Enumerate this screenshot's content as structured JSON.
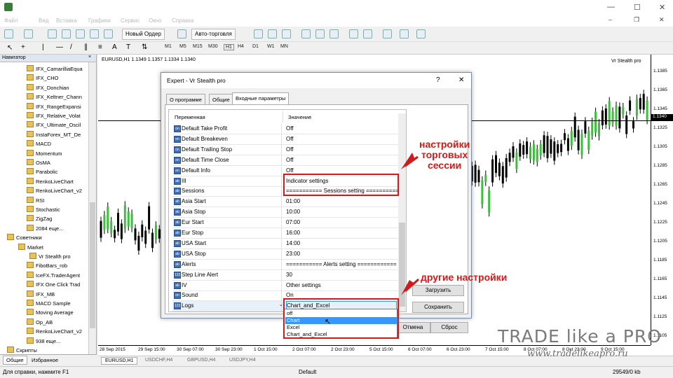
{
  "menu": [
    "Файл",
    "Вид",
    "Вставка",
    "Графики",
    "Сервис",
    "Окно",
    "Справка"
  ],
  "toolbar": {
    "new_order": "Новый Ордер",
    "auto_trading": "Авто-торговля"
  },
  "timeframes": [
    "M1",
    "M5",
    "M15",
    "M30",
    "H1",
    "H4",
    "D1",
    "W1",
    "MN"
  ],
  "navigator": {
    "title": "Навигатор",
    "items": [
      "IFX_CamarilliaEqua",
      "IFX_CHO",
      "IFX_Donchian",
      "IFX_Keltner_Chann",
      "IFX_RangeExpansi",
      "IFX_Relative_Volat",
      "IFX_Ultimate_Oscil",
      "InstaForex_MT_De",
      "MACD",
      "Momentum",
      "OsMA",
      "Parabolic",
      "RenkoLiveChart",
      "RenkoLiveChart_v2",
      "RSI",
      "Stochastic",
      "ZigZag",
      "2084 еще..."
    ],
    "advisors_label": "Советники",
    "market_label": "Market",
    "market_item": "Vr Stealth pro",
    "advisor_items": [
      "FiboBars_rob",
      "IceFX.TraderAgent",
      "IFX One Click Trad",
      "IFX_MB",
      "MACD Sample",
      "Moving Average",
      "Op_AB",
      "RenkoLiveChart_v2",
      "938 еще..."
    ],
    "scripts_label": "Скрипты",
    "tabs": [
      "Общие",
      "Избранное"
    ]
  },
  "chart": {
    "header": "EURUSD,H1  1.1349 1.1357 1.1334 1.1340",
    "name": "Vr Stealth pro",
    "prices": [
      "1.1385",
      "1.1365",
      "1.1345",
      "1.1325",
      "1.1305",
      "1.1285",
      "1.1265",
      "1.1245",
      "1.1225",
      "1.1205",
      "1.1185",
      "1.1165",
      "1.1145",
      "1.1125",
      "1.1105"
    ],
    "current_price": "1.1340",
    "time_labels": [
      "28 Sep 2015",
      "29 Sep 15:00",
      "30 Sep 07:00",
      "30 Sep 23:00",
      "1 Oct 15:00",
      "2 Oct 07:00",
      "2 Oct 23:00",
      "5 Oct 15:00",
      "6 Oct 07:00",
      "6 Oct 23:00",
      "7 Oct 15:00",
      "8 Oct 07:00",
      "8 Oct 23:00",
      "9 Oct 15:00"
    ],
    "tabs": [
      "EURUSD,H1",
      "USDCHF,H4",
      "GBPUSD,H4",
      "USDJPY,H4"
    ]
  },
  "status": {
    "help": "Для справки, нажмите F1",
    "profile": "Default",
    "traffic": "29549/0 kb"
  },
  "dialog": {
    "title": "Expert - Vr Stealth pro",
    "help_btn": "?",
    "close_btn": "✕",
    "tabs": [
      "О программе",
      "Общие",
      "Входные параметры"
    ],
    "col_var": "Переменная",
    "col_val": "Значение",
    "rows": [
      {
        "type": "bool",
        "name": "Default Take Profit",
        "value": "Off"
      },
      {
        "type": "bool",
        "name": "Default Breakeven",
        "value": "Off"
      },
      {
        "type": "bool",
        "name": "Default Trailing Stop",
        "value": "Off"
      },
      {
        "type": "bool",
        "name": "Default Time Close",
        "value": "Off"
      },
      {
        "type": "bool",
        "name": "Default Info",
        "value": "Off"
      },
      {
        "type": "abc",
        "name": "III",
        "value": "Indicator settings"
      },
      {
        "type": "abc",
        "name": "Sessions",
        "value": "=========== Sessions setting =========="
      },
      {
        "type": "abc",
        "name": "Asia Start",
        "value": "01:00"
      },
      {
        "type": "abc",
        "name": "Asia Stop",
        "value": "10:00"
      },
      {
        "type": "abc",
        "name": "Eur Start",
        "value": "07:00"
      },
      {
        "type": "abc",
        "name": "Eur Stop",
        "value": "16:00"
      },
      {
        "type": "abc",
        "name": "USA Start",
        "value": "14:00"
      },
      {
        "type": "abc",
        "name": "USA Stop",
        "value": "23:00"
      },
      {
        "type": "abc",
        "name": "Alerts",
        "value": "=========== Alerts setting ============"
      },
      {
        "type": "123",
        "name": "Step Line Alert",
        "value": "30"
      },
      {
        "type": "abc",
        "name": "IV",
        "value": "Other settings"
      },
      {
        "type": "bool",
        "name": "Sound",
        "value": "On"
      },
      {
        "type": "123",
        "name": "Logs",
        "value": "Chart_and_Excel"
      }
    ],
    "dropdown_options": [
      "off",
      "Chart",
      "Excel",
      "Chart_and_Excel"
    ],
    "load_btn": "Загрузить",
    "save_btn": "Сохранить",
    "cancel_btn": "Отмена",
    "reset_btn": "Сброс"
  },
  "annotations": {
    "session_settings": "настройки\nторговых\nсессии",
    "other_settings": "другие настройки"
  },
  "watermark": {
    "brand": "TRADE like a PRO",
    "url": "www.tradelikeapro.ru"
  },
  "colors": {
    "annotation_red": "#d31a1a",
    "selection_blue": "#3399ff",
    "bull_candle": "#3ac03a"
  }
}
